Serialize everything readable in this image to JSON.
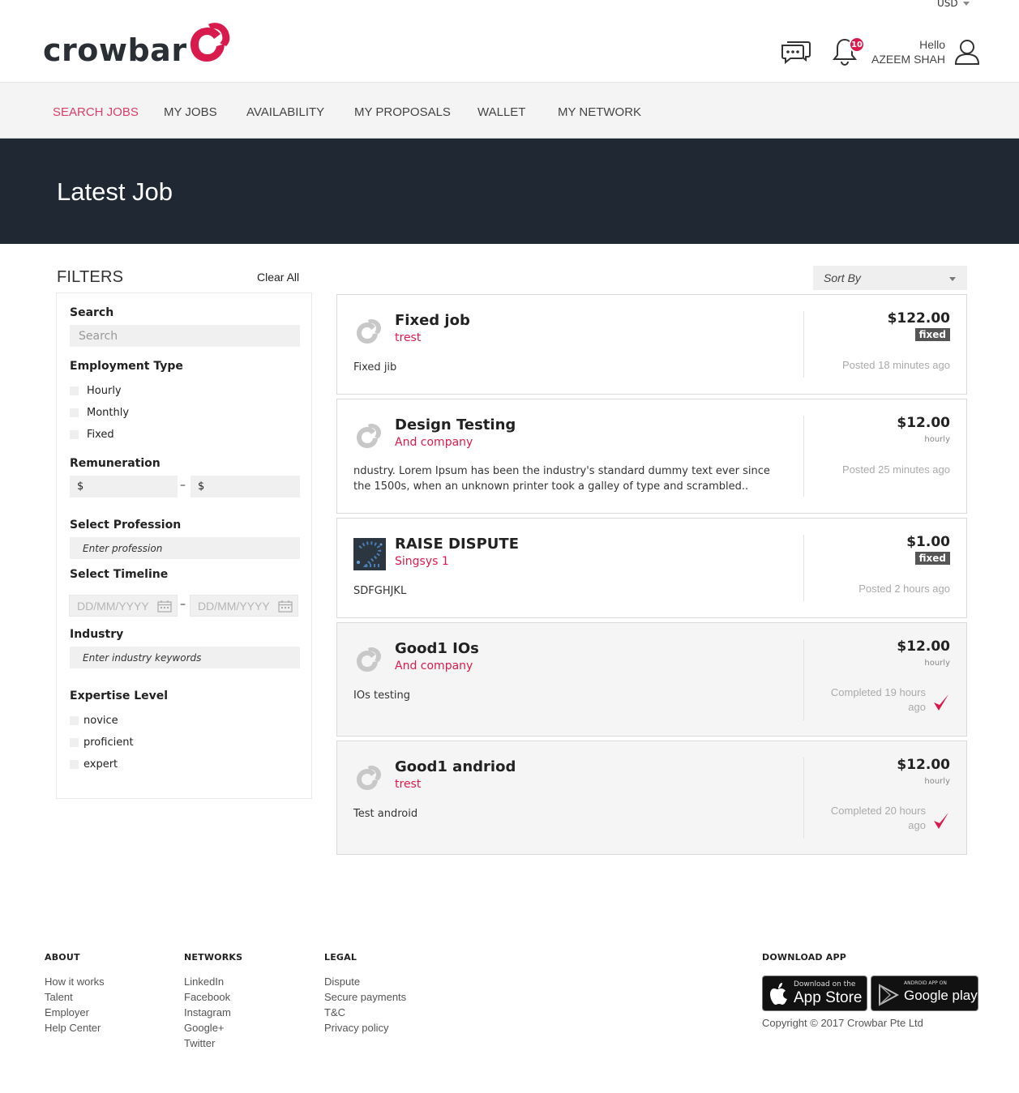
{
  "header": {
    "currency": "USD",
    "logo_text": "crowbar",
    "notification_count": "10",
    "greeting": "Hello",
    "user_name": "AZEEM SHAH"
  },
  "nav": {
    "items": [
      {
        "label": "SEARCH JOBS",
        "active": true
      },
      {
        "label": "MY JOBS"
      },
      {
        "label": "AVAILABILITY"
      },
      {
        "label": "MY PROPOSALS"
      },
      {
        "label": "WALLET"
      },
      {
        "label": "MY NETWORK"
      }
    ]
  },
  "hero": {
    "title": "Latest Job"
  },
  "filters": {
    "title": "FILTERS",
    "clear_all": "Clear All",
    "search_label": "Search",
    "search_placeholder": "Search",
    "employment_label": "Employment Type",
    "employment_options": [
      "Hourly",
      "Monthly",
      "Fixed"
    ],
    "remuneration_label": "Remuneration",
    "currency_symbol": "$",
    "range_dash": "–",
    "profession_label": "Select Profession",
    "profession_placeholder": "Enter profession",
    "timeline_label": "Select Timeline",
    "date_placeholder": "DD/MM/YYYY",
    "industry_label": "Industry",
    "industry_placeholder": "Enter industry keywords",
    "expertise_label": "Expertise Level",
    "expertise_options": [
      "novice",
      "proficient",
      "expert"
    ]
  },
  "sort": {
    "label": "Sort By"
  },
  "jobs": [
    {
      "title": "Fixed job",
      "company": "trest",
      "description": "Fixed jib",
      "price": "$122.00",
      "rate_type": "fixed",
      "status": "Posted 18 minutes ago"
    },
    {
      "title": "Design Testing",
      "company": "And company",
      "description": "ndustry. Lorem Ipsum has been the industry's standard dummy text ever since the 1500s, when an unknown printer took a galley of type and scrambled..",
      "price": "$12.00",
      "rate_type": "hourly",
      "status": "Posted 25 minutes ago"
    },
    {
      "title": "RAISE DISPUTE",
      "company": "Singsys 1",
      "description": "SDFGHJKL",
      "price": "$1.00",
      "rate_type": "fixed",
      "status": "Posted 2 hours ago"
    },
    {
      "title": "Good1 IOs",
      "company": "And company",
      "description": "IOs testing",
      "price": "$12.00",
      "rate_type": "hourly",
      "status": "Completed 19 hours ago"
    },
    {
      "title": "Good1 andriod",
      "company": "trest",
      "description": "Test android",
      "price": "$12.00",
      "rate_type": "hourly",
      "status": "Completed 20 hours ago"
    }
  ],
  "footer": {
    "about": {
      "title": "ABOUT",
      "links": [
        "How it works",
        "Talent",
        "Employer",
        "Help Center"
      ]
    },
    "networks": {
      "title": "NETWORKS",
      "links": [
        "LinkedIn",
        "Facebook",
        "Instagram",
        "Google+",
        "Twitter"
      ]
    },
    "legal": {
      "title": "LEGAL",
      "links": [
        "Dispute",
        "Secure payments",
        "T&C",
        "Privacy policy"
      ]
    },
    "download": {
      "title": "DOWNLOAD APP",
      "appstore_small": "Download on the",
      "appstore_big": "App Store",
      "googleplay_small": "ANDROID APP ON",
      "googleplay_big": "Google play"
    },
    "copyright": "Copyright © 2017 Crowbar Pte Ltd"
  },
  "colors": {
    "accent": "#d81b4c",
    "hero_bg": "#202833",
    "nav_bg": "#f4f4f4"
  }
}
